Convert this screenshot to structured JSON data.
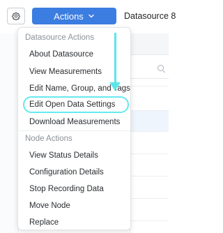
{
  "topbar": {
    "actions_label": "Actions",
    "datasource_title": "Datasource 8"
  },
  "menu": {
    "sections": [
      {
        "title": "Datasource Actions",
        "items": [
          "About Datasource",
          "View Measurements",
          "Edit Name, Group, and Tags",
          "Edit Open Data Settings",
          "Download Measurements"
        ]
      },
      {
        "title": "Node Actions",
        "items": [
          "View Status Details",
          "Configuration Details",
          "Stop Recording Data",
          "Move Node",
          "Replace"
        ]
      }
    ],
    "highlighted_item": "Edit Open Data Settings"
  },
  "colors": {
    "accent": "#3b7de0",
    "annotation": "#5ae6ea"
  }
}
